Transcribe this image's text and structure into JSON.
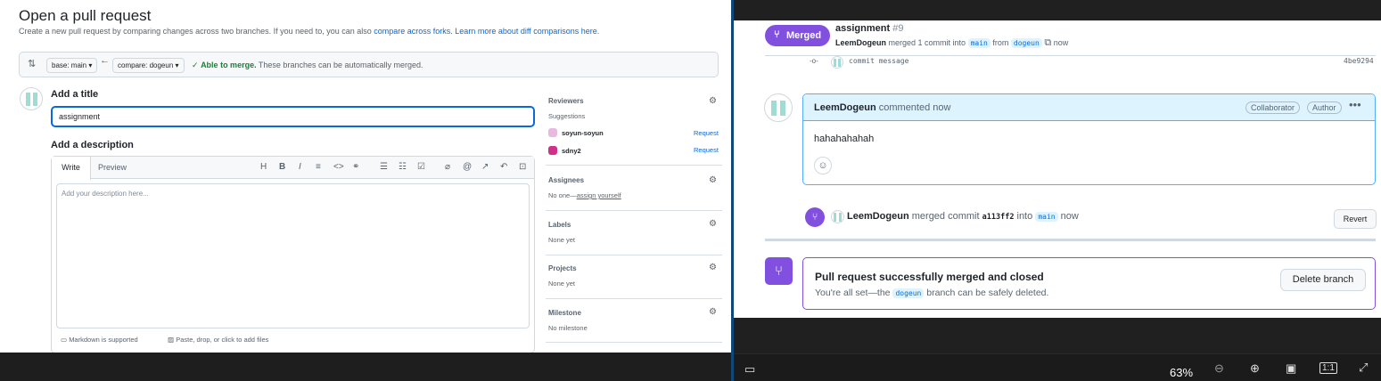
{
  "left": {
    "title": "Open a pull request",
    "subtitle_text": "Create a new pull request by comparing changes across two branches. If you need to, you can also",
    "subtitle_link1": "compare across forks.",
    "subtitle_link2": "Learn more about diff comparisons here.",
    "base_label": "base: main",
    "compare_label": "compare: dogeun",
    "merge_ok_bold": "Able to merge.",
    "merge_ok_rest": "These branches can be automatically merged.",
    "add_title_label": "Add a title",
    "title_value": "assignment",
    "add_description_label": "Add a description",
    "tab_write": "Write",
    "tab_preview": "Preview",
    "description_placeholder": "Add your description here...",
    "markdown_note": "Markdown is supported",
    "attach_note": "Paste, drop, or click to add files",
    "sidebar": {
      "reviewers": "Reviewers",
      "suggestions": "Suggestions",
      "reviewer1": "soyun-soyun",
      "reviewer2": "sdny2",
      "request": "Request",
      "assignees": "Assignees",
      "assignees_value_prefix": "No one—",
      "assign_yourself": "assign yourself",
      "labels": "Labels",
      "labels_value": "None yet",
      "projects": "Projects",
      "projects_value": "None yet",
      "milestone": "Milestone",
      "milestone_value": "No milestone"
    }
  },
  "right": {
    "badge": "Merged",
    "pr_title": "assignment",
    "pr_number": "#9",
    "meta_user": "LeemDogeun",
    "meta_text1": "merged 1 commit into",
    "meta_base": "main",
    "meta_from": "from",
    "meta_head": "dogeun",
    "meta_time": "now",
    "commit_message": "commit message",
    "commit_sha": "4be9294",
    "comment_author": "LeemDogeun",
    "comment_when": "commented now",
    "pill_collaborator": "Collaborator",
    "pill_author": "Author",
    "comment_body": "hahahahahah",
    "event_user": "LeemDogeun",
    "event_text1": "merged commit",
    "event_sha": "a113ff2",
    "event_into": "into",
    "event_base": "main",
    "event_time": "now",
    "revert": "Revert",
    "merged_title": "Pull request successfully merged and closed",
    "merged_sub1": "You're all set—the",
    "merged_branch": "dogeun",
    "merged_sub2": "branch can be safely deleted.",
    "delete_branch": "Delete branch"
  },
  "viewer_bar": {
    "zoom_level": "63%"
  }
}
